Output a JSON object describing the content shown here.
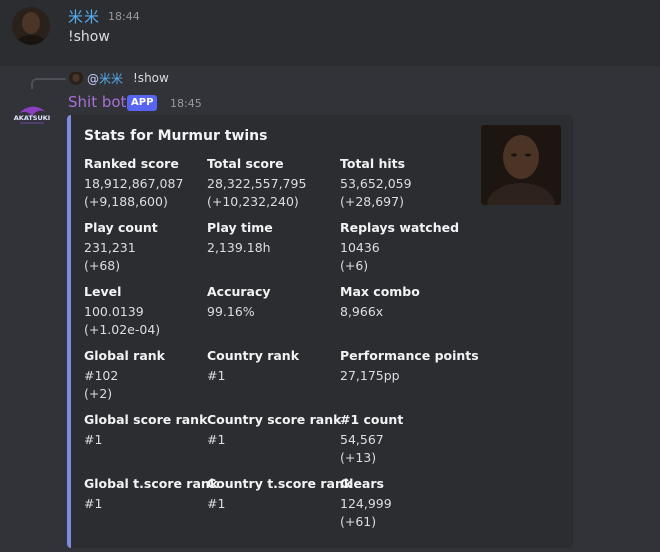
{
  "message1": {
    "username": "米米",
    "timestamp": "18:44",
    "content": "!show"
  },
  "reply": {
    "at": "@",
    "username": "米米",
    "content": "!show"
  },
  "bot_message": {
    "bot_name": "Shit bot",
    "badge": "APP",
    "timestamp": "18:45",
    "avatar_text": "AKATSUKI"
  },
  "embed": {
    "accent_color": "#7f8be0",
    "title": "Stats for Murmur twins",
    "fields": [
      {
        "name": "Ranked score",
        "lines": [
          "18,912,867,087",
          "(+9,188,600)"
        ]
      },
      {
        "name": "Total score",
        "lines": [
          "28,322,557,795",
          "(+10,232,240)"
        ]
      },
      {
        "name": "Total hits",
        "lines": [
          "53,652,059",
          "(+28,697)"
        ]
      },
      {
        "name": "Play count",
        "lines": [
          "231,231",
          "(+68)"
        ]
      },
      {
        "name": "Play time",
        "lines": [
          "2,139.18h"
        ]
      },
      {
        "name": "Replays watched",
        "lines": [
          "10436",
          "(+6)"
        ]
      },
      {
        "name": "Level",
        "lines": [
          "100.0139",
          "(+1.02e-04)"
        ]
      },
      {
        "name": "Accuracy",
        "lines": [
          "99.16%"
        ]
      },
      {
        "name": "Max combo",
        "lines": [
          "8,966x"
        ]
      },
      {
        "name": "Global rank",
        "lines": [
          "#102",
          "(+2)"
        ]
      },
      {
        "name": "Country rank",
        "lines": [
          "#1"
        ]
      },
      {
        "name": "Performance points",
        "lines": [
          "27,175pp"
        ]
      },
      {
        "name": "Global score rank",
        "lines": [
          "#1"
        ]
      },
      {
        "name": "Country score rank",
        "lines": [
          "#1"
        ]
      },
      {
        "name": "#1 count",
        "lines": [
          "54,567",
          "(+13)"
        ]
      },
      {
        "name": "Global t.score rank",
        "lines": [
          "#1"
        ]
      },
      {
        "name": "Country t.score rank",
        "lines": [
          "#1"
        ]
      },
      {
        "name": "Clears",
        "lines": [
          "124,999",
          "(+61)"
        ]
      }
    ]
  }
}
